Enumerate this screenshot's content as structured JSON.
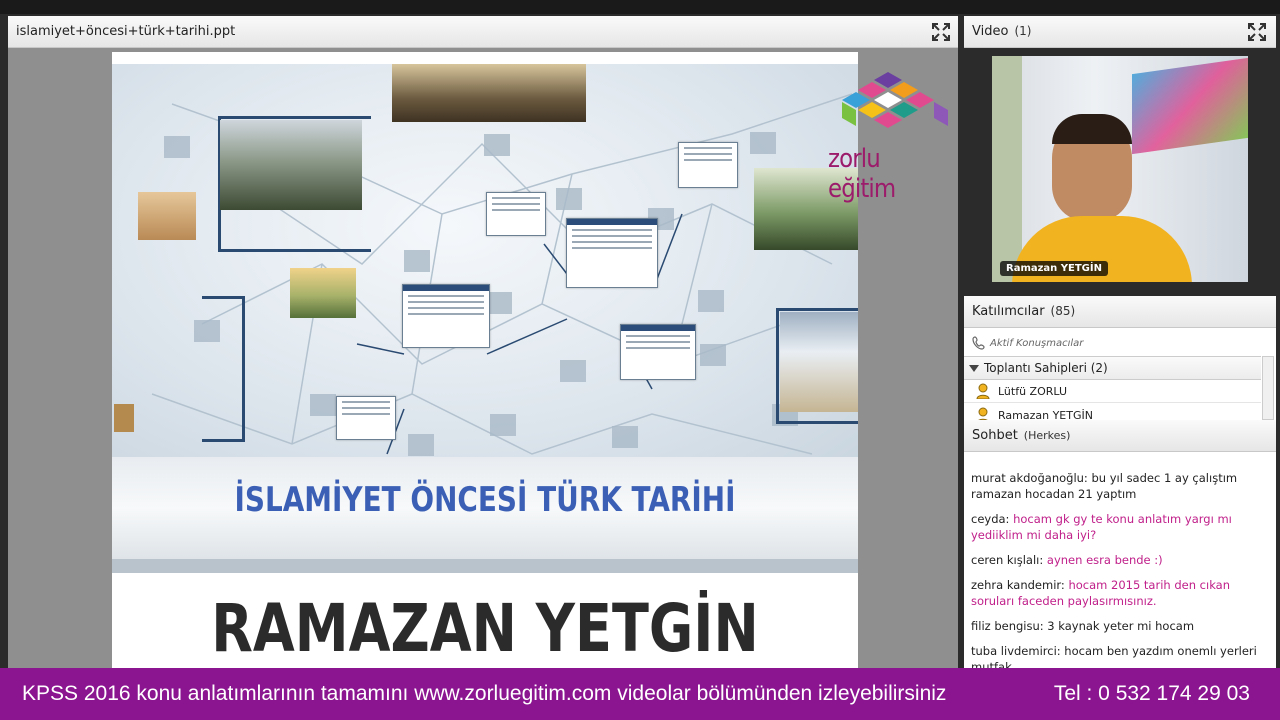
{
  "presentation": {
    "file_title": "islamiyet+öncesi+türk+tarihi.ppt",
    "slide_title": "İSLAMİYET ÖNCESİ TÜRK TARİHİ",
    "slide_author": "RAMAZAN YETGİN",
    "logo_text": "zorlu eğitim"
  },
  "video": {
    "title": "Video",
    "count": "(1)",
    "presenter_name": "Ramazan YETGİN"
  },
  "participants": {
    "title": "Katılımcılar",
    "count": "(85)",
    "active_speakers": "Aktif Konuşmacılar",
    "group_label": "Toplantı Sahipleri (2)",
    "members": [
      "Lütfü ZORLU",
      "Ramazan YETGİN"
    ]
  },
  "chat": {
    "title": "Sohbet",
    "scope": "(Herkes)",
    "messages": [
      {
        "name": "murat akdoğanoğlu:",
        "text": "bu yıl sadec 1 ay çalıştım ramazan hocadan 21 yaptım",
        "color": "#222222"
      },
      {
        "name": "ceyda:",
        "text": "hocam gk gy te konu anlatım yargı mı yediiklim mi daha iyi?",
        "color": "#c0208a"
      },
      {
        "name": "ceren kışlalı:",
        "text": "aynen esra bende :)",
        "color": "#c0208a"
      },
      {
        "name": "zehra kandemir:",
        "text": "hocam 2015 tarih den cıkan soruları faceden paylasırmısınız.",
        "color": "#c0208a"
      },
      {
        "name": "filiz bengisu:",
        "text": "3 kaynak yeter mi hocam",
        "color": "#222222"
      },
      {
        "name": "tuba livdemirci:",
        "text": "hocam ben yazdım onemlı yerleri mutfak",
        "color": "#222222"
      }
    ]
  },
  "footer": {
    "text": "KPSS 2016 konu anlatımlarının tamamını www.zorluegitim.com videolar bölümünden izleyebilirsiniz",
    "phone": "Tel : 0 532 174 29 03"
  },
  "colors": {
    "footer_bg": "#8b1590",
    "title_blue": "#3b5fb5",
    "chat_pink": "#c0208a"
  }
}
